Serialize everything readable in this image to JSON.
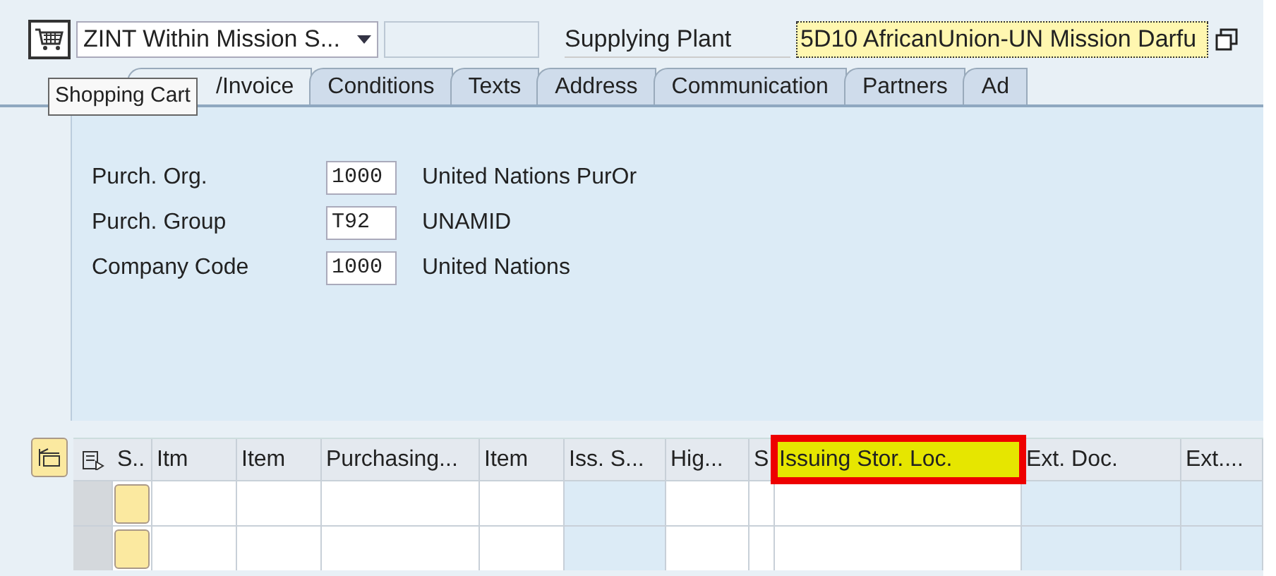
{
  "header": {
    "order_type": "ZINT Within Mission S...",
    "supplying_plant_label": "Supplying Plant",
    "supplying_plant_value": "5D10 AfricanUnion-UN Mission Darfu"
  },
  "tooltip": "Shopping Cart",
  "tabs": [
    {
      "label": "/Invoice",
      "selected": true
    },
    {
      "label": "Conditions",
      "selected": false
    },
    {
      "label": "Texts",
      "selected": false
    },
    {
      "label": "Address",
      "selected": false
    },
    {
      "label": "Communication",
      "selected": false
    },
    {
      "label": "Partners",
      "selected": false
    },
    {
      "label": "Ad",
      "selected": false
    }
  ],
  "fields": [
    {
      "label": "Purch. Org.",
      "value": "1000",
      "description": "United Nations PurOr"
    },
    {
      "label": "Purch. Group",
      "value": "T92",
      "description": "UNAMID"
    },
    {
      "label": "Company Code",
      "value": "1000",
      "description": "United Nations"
    }
  ],
  "table": {
    "columns": [
      {
        "label": "S..",
        "editable": true,
        "highlighted": false
      },
      {
        "label": "Itm",
        "editable": true,
        "highlighted": false
      },
      {
        "label": "Item",
        "editable": true,
        "highlighted": false
      },
      {
        "label": "Purchasing...",
        "editable": true,
        "highlighted": false
      },
      {
        "label": "Item",
        "editable": true,
        "highlighted": false
      },
      {
        "label": "Iss. S...",
        "editable": false,
        "highlighted": false
      },
      {
        "label": "Hig...",
        "editable": true,
        "highlighted": false
      },
      {
        "label": "S",
        "editable": true,
        "highlighted": false
      },
      {
        "label": "Issuing Stor. Loc.",
        "editable": true,
        "highlighted": true
      },
      {
        "label": "Ext. Doc.",
        "editable": false,
        "highlighted": false
      },
      {
        "label": "Ext....",
        "editable": false,
        "highlighted": false
      }
    ],
    "rows": [
      {
        "selected": false
      },
      {
        "selected": false
      }
    ]
  }
}
